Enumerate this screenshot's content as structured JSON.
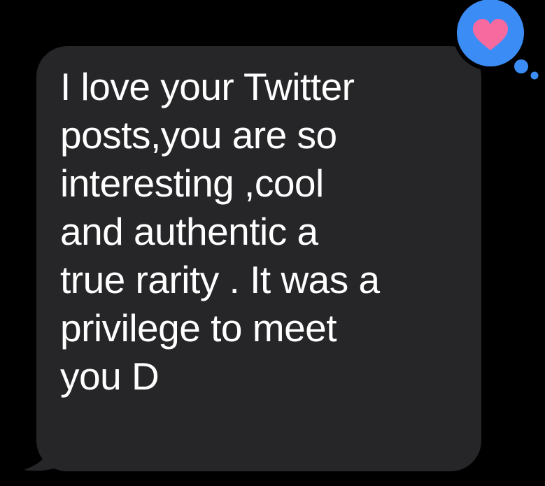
{
  "message": {
    "lines": [
      "I love your Twitter",
      "posts,you are so",
      "interesting ,cool",
      "and authentic a",
      "true rarity . It was a",
      "privilege to meet",
      "you D"
    ],
    "bubble_color": "#262628",
    "text_color": "#ffffff"
  },
  "tapback": {
    "icon": "heart-icon",
    "badge_color": "#3b8df5",
    "heart_color": "#f76aa0"
  }
}
